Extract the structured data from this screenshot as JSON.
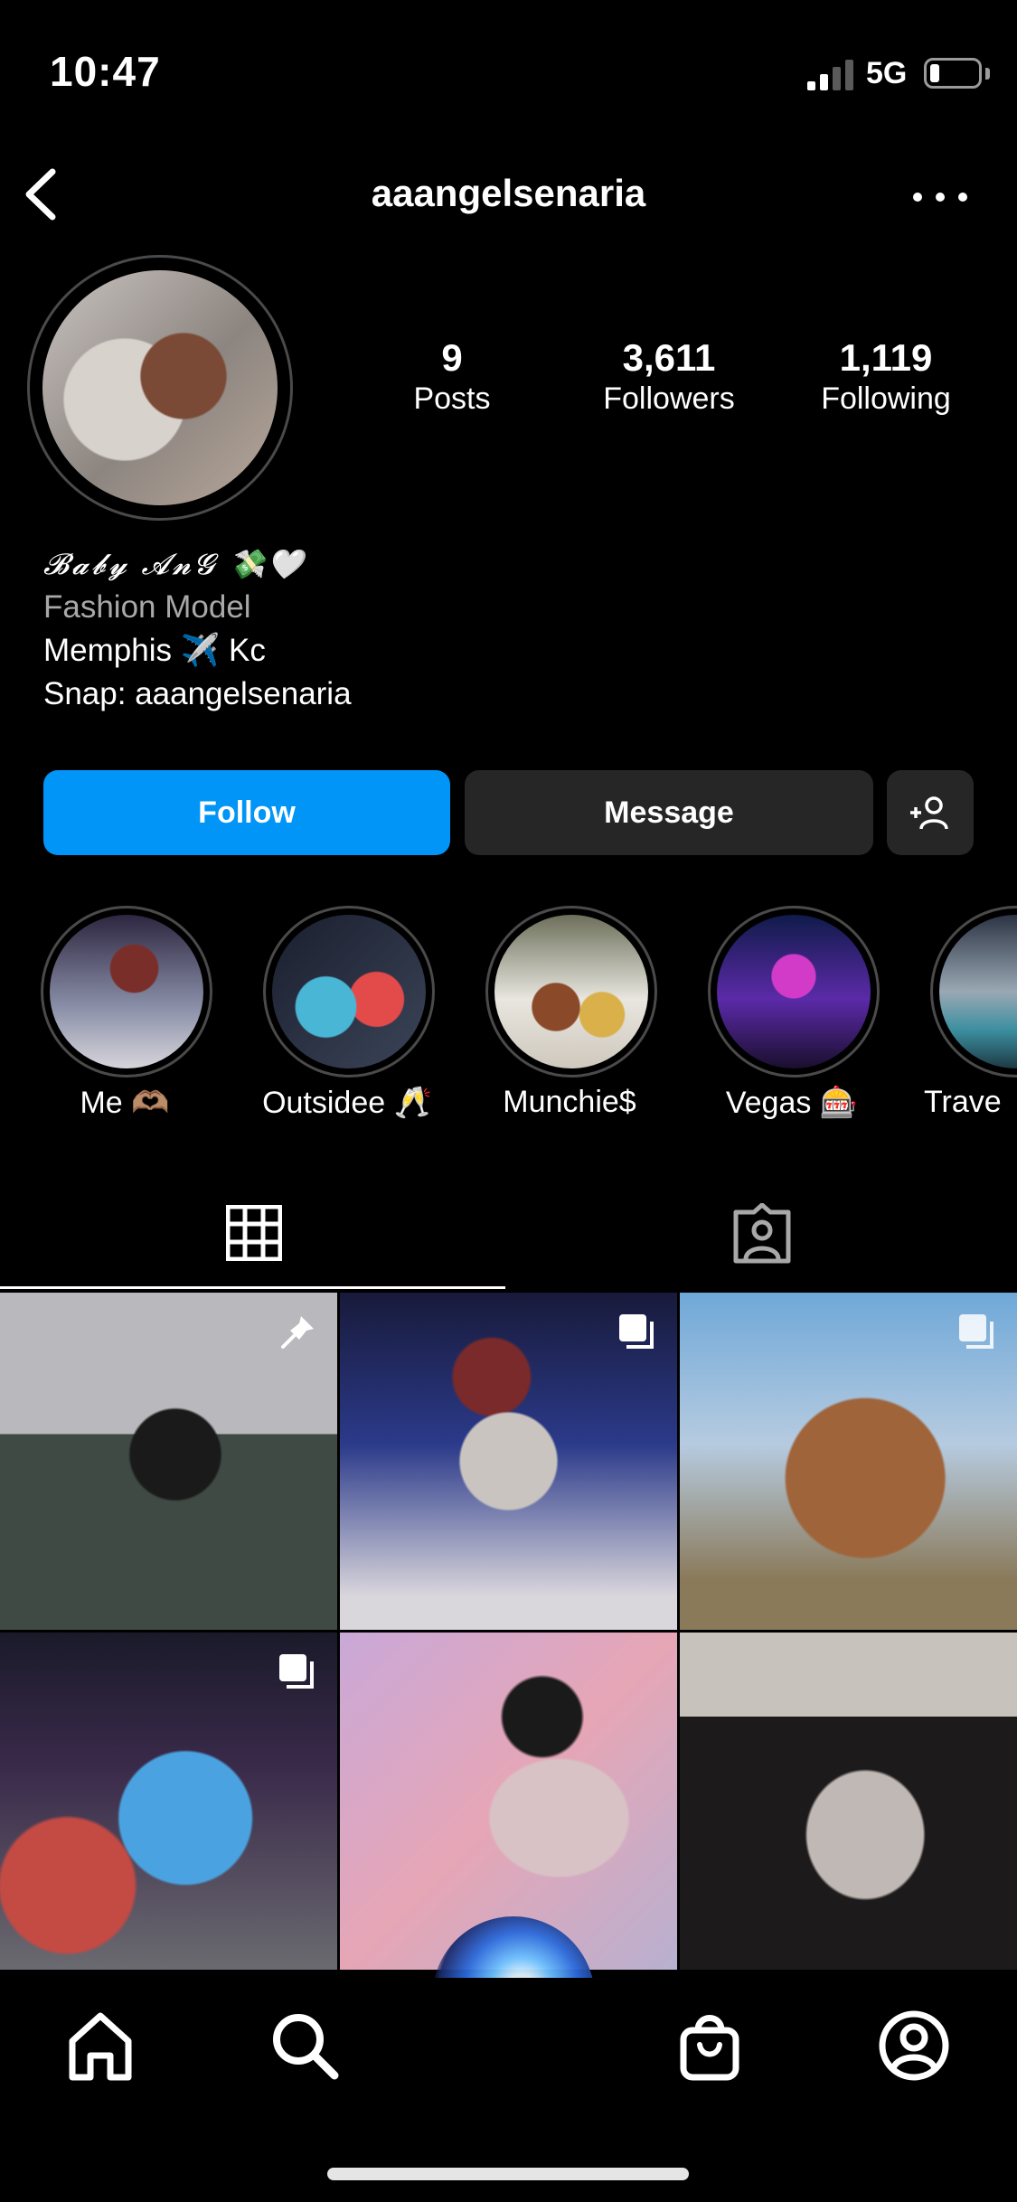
{
  "status_bar": {
    "time": "10:47",
    "network": "5G"
  },
  "header": {
    "username": "aaangelsenaria"
  },
  "stats": [
    {
      "value": "9",
      "label": "Posts"
    },
    {
      "value": "3,611",
      "label": "Followers"
    },
    {
      "value": "1,119",
      "label": "Following"
    }
  ],
  "bio": {
    "name": "𝓑𝓪𝓫𝔂 𝓐𝓷𝓖 💸🤍",
    "category": "Fashion Model",
    "line1": "Memphis ✈️ Kc",
    "line2": "Snap: aaangelsenaria"
  },
  "actions": {
    "follow": "Follow",
    "message": "Message"
  },
  "highlights": [
    {
      "label": "Me 🫶🏽"
    },
    {
      "label": "Outsidee 🥂"
    },
    {
      "label": "Munchie$"
    },
    {
      "label": "Vegas 🎰"
    },
    {
      "label": "Trave"
    }
  ],
  "colors": {
    "accent": "#0095f6",
    "button_dark": "#262626",
    "background": "#000000"
  }
}
